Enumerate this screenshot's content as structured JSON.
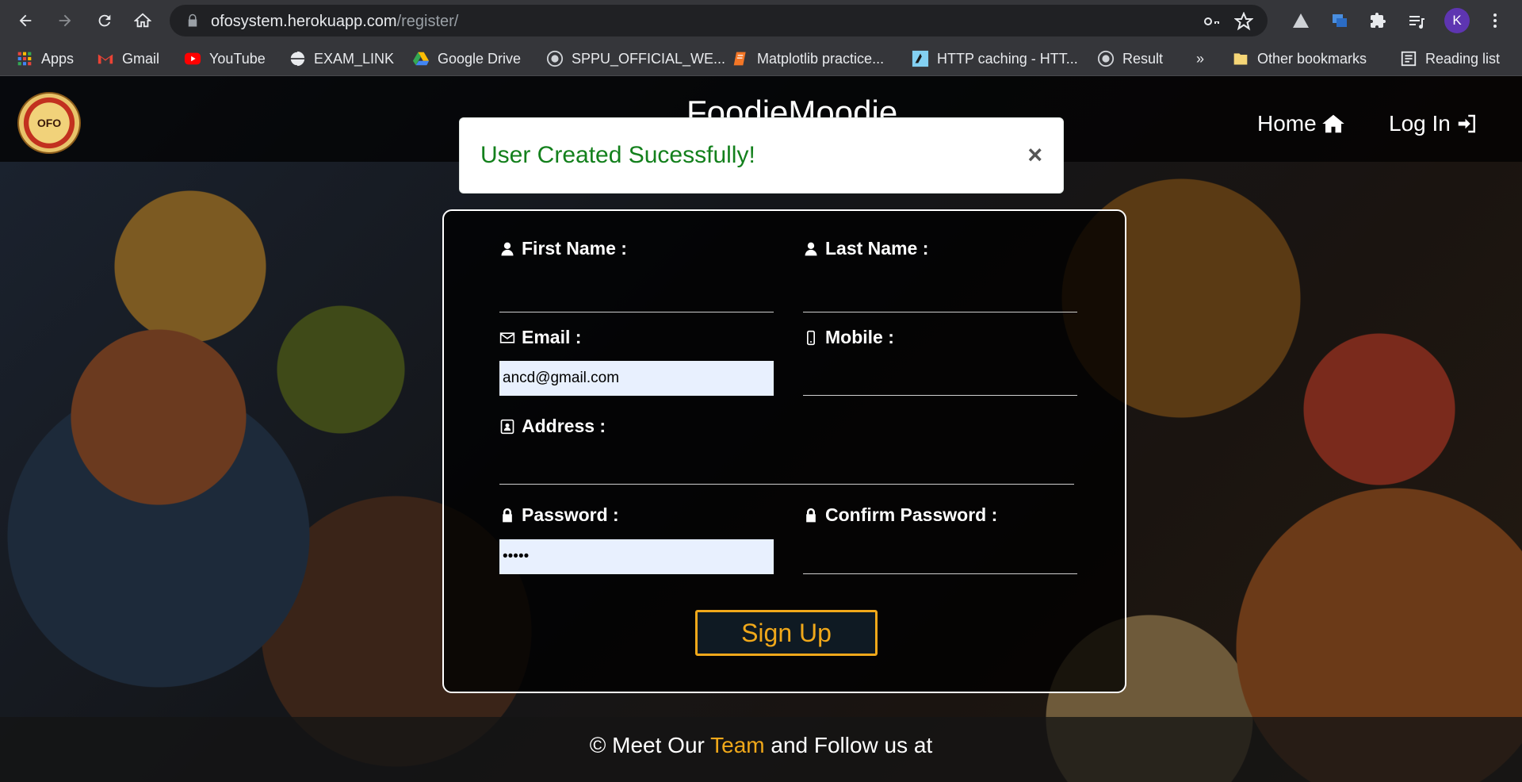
{
  "browser": {
    "url_host": "ofosystem.herokuapp.com",
    "url_path": "/register/",
    "profile_initial": "K",
    "bookmarks": [
      {
        "label": "Apps",
        "icon": "apps-grid-icon"
      },
      {
        "label": "Gmail",
        "icon": "gmail-icon"
      },
      {
        "label": "YouTube",
        "icon": "youtube-icon"
      },
      {
        "label": "EXAM_LINK",
        "icon": "globe-icon"
      },
      {
        "label": "Google Drive",
        "icon": "google-drive-icon"
      },
      {
        "label": "SPPU_OFFICIAL_WE...",
        "icon": "seal-icon"
      },
      {
        "label": "Matplotlib practice...",
        "icon": "notebook-icon"
      },
      {
        "label": "HTTP caching - HTT...",
        "icon": "mdn-icon"
      },
      {
        "label": "Result",
        "icon": "seal-icon"
      }
    ],
    "overflow": "»",
    "other_bookmarks": "Other bookmarks",
    "reading_list": "Reading list"
  },
  "site": {
    "brand": "FoodieMoodie",
    "logo_text": "OFO",
    "nav": {
      "home": "Home",
      "login": "Log In"
    }
  },
  "alert": {
    "message": "User Created Sucessfully!",
    "close": "×"
  },
  "form": {
    "first_name_label": "First Name :",
    "last_name_label": "Last Name :",
    "email_label": "Email :",
    "email_value": "ancd@gmail.com",
    "mobile_label": "Mobile :",
    "address_label": "Address :",
    "password_label": "Password :",
    "password_value": "•••••",
    "confirm_password_label": "Confirm Password :",
    "submit": "Sign Up"
  },
  "footer": {
    "prefix": "© Meet Our ",
    "team": "Team",
    "suffix": " and Follow us at"
  },
  "colors": {
    "accent": "#f0a81a",
    "success": "#13801c",
    "chrome": "#35363a"
  }
}
